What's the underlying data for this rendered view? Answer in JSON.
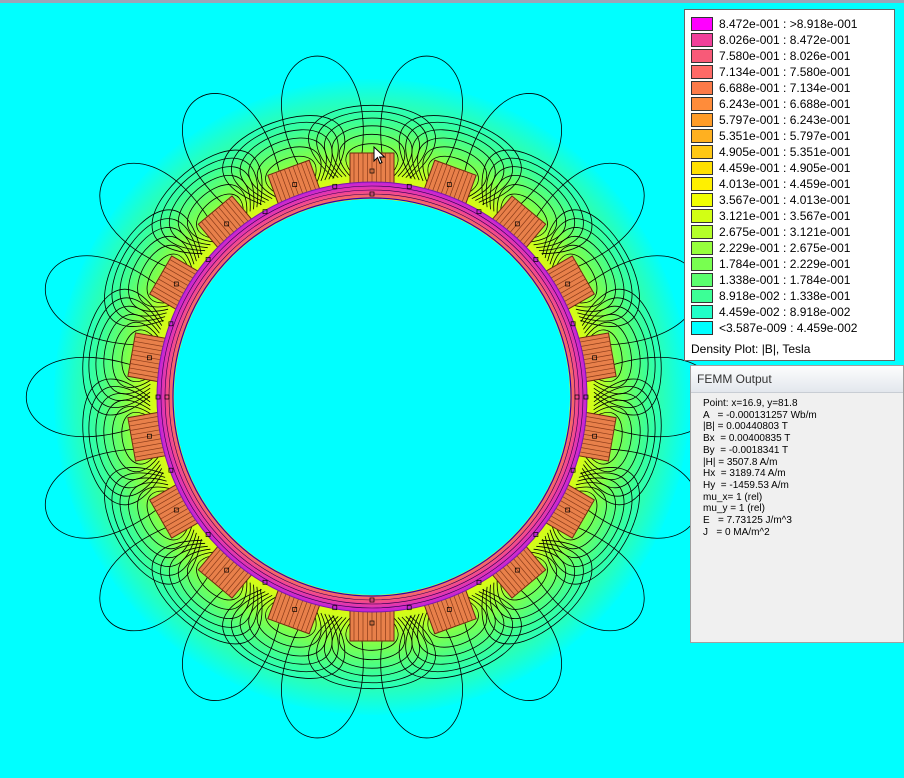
{
  "legend": {
    "caption": "Density Plot: |B|, Tesla",
    "entries": [
      {
        "label": "8.472e-001 : >8.918e-001",
        "color": "#ff00ff"
      },
      {
        "label": "8.026e-001 : 8.472e-001",
        "color": "#f0409a"
      },
      {
        "label": "7.580e-001 : 8.026e-001",
        "color": "#f85a78"
      },
      {
        "label": "7.134e-001 : 7.580e-001",
        "color": "#ff6a66"
      },
      {
        "label": "6.688e-001 : 7.134e-001",
        "color": "#fc7a48"
      },
      {
        "label": "6.243e-001 : 6.688e-001",
        "color": "#ff8c3a"
      },
      {
        "label": "5.797e-001 : 6.243e-001",
        "color": "#ff9c28"
      },
      {
        "label": "5.351e-001 : 5.797e-001",
        "color": "#ffb020"
      },
      {
        "label": "4.905e-001 : 5.351e-001",
        "color": "#ffc814"
      },
      {
        "label": "4.459e-001 : 4.905e-001",
        "color": "#ffe000"
      },
      {
        "label": "4.013e-001 : 4.459e-001",
        "color": "#fff000"
      },
      {
        "label": "3.567e-001 : 4.013e-001",
        "color": "#f0ff00"
      },
      {
        "label": "3.121e-001 : 3.567e-001",
        "color": "#d2ff14"
      },
      {
        "label": "2.675e-001 : 3.121e-001",
        "color": "#b4ff28"
      },
      {
        "label": "2.229e-001 : 2.675e-001",
        "color": "#96ff3c"
      },
      {
        "label": "1.784e-001 : 2.229e-001",
        "color": "#78ff50"
      },
      {
        "label": "1.338e-001 : 1.784e-001",
        "color": "#5aff6e"
      },
      {
        "label": "8.918e-002 : 1.338e-001",
        "color": "#3cff96"
      },
      {
        "label": "4.459e-002 : 8.918e-002",
        "color": "#20ffc8"
      },
      {
        "label": "<3.587e-009 : 4.459e-002",
        "color": "#00ffff"
      }
    ]
  },
  "output": {
    "title": "FEMM Output",
    "lines": [
      "Point: x=16.9, y=81.8",
      "A   = -0.000131257 Wb/m",
      "|B| = 0.00440803 T",
      "Bx  = 0.00400835 T",
      "By  = -0.0018341 T",
      "|H| = 3507.8 A/m",
      "Hx  = 3189.74 A/m",
      "Hy  = -1459.53 A/m",
      "mu_x= 1 (rel)",
      "mu_y = 1 (rel)",
      "E   = 7.73125 J/m^3",
      "J   = 0 MA/m^2"
    ]
  }
}
